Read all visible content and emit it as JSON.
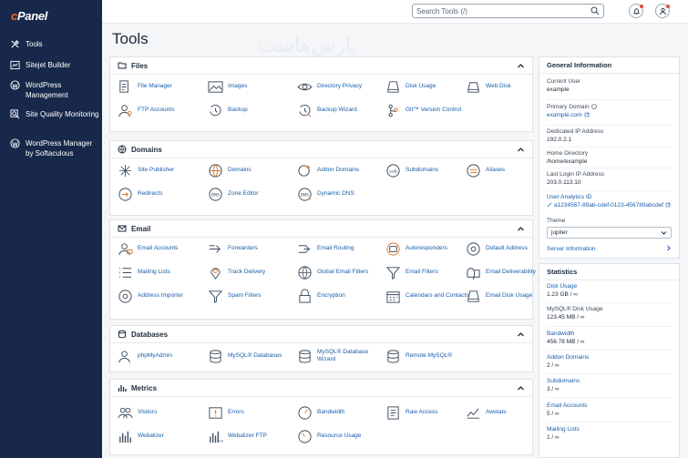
{
  "brand": {
    "logo_c": "c",
    "logo_rest": "Panel"
  },
  "sidebar": {
    "items": [
      {
        "label": "Tools",
        "icon": "tools-icon"
      },
      {
        "label": "Sitejet Builder",
        "icon": "sitejet-icon"
      },
      {
        "label": "WordPress Management",
        "icon": "wordpress-icon"
      },
      {
        "label": "Site Quality Monitoring",
        "icon": "magnifier-icon"
      },
      {
        "label": "WordPress Manager by Softaculous",
        "icon": "wordpress-icon"
      }
    ]
  },
  "header": {
    "search_placeholder": "Search Tools (/)"
  },
  "watermark": "پارس‌هاست",
  "page": {
    "title": "Tools"
  },
  "sections": {
    "files": {
      "title": "Files",
      "tools": [
        "File Manager",
        "Images",
        "Directory Privacy",
        "Disk Usage",
        "Web Disk",
        "FTP Accounts",
        "Backup",
        "Backup Wizard",
        "Git™ Version Control"
      ]
    },
    "domains": {
      "title": "Domains",
      "tools": [
        "Site Publisher",
        "Domains",
        "Addon Domains",
        "Subdomains",
        "Aliases",
        "Redirects",
        "Zone Editor",
        "Dynamic DNS"
      ]
    },
    "email": {
      "title": "Email",
      "tools": [
        "Email Accounts",
        "Forwarders",
        "Email Routing",
        "Autoresponders",
        "Default Address",
        "Mailing Lists",
        "Track Delivery",
        "Global Email Filters",
        "Email Filters",
        "Email Deliverability",
        "Address Importer",
        "Spam Filters",
        "Encryption",
        "Calendars and Contacts",
        "Email Disk Usage"
      ]
    },
    "databases": {
      "title": "Databases",
      "tools": [
        "phpMyAdmin",
        "MySQL® Databases",
        "MySQL® Database Wizard",
        "Remote MySQL®"
      ]
    },
    "metrics": {
      "title": "Metrics",
      "tools": [
        "Visitors",
        "Errors",
        "Bandwidth",
        "Raw Access",
        "Awstats",
        "Webalizer",
        "Webalizer FTP",
        "Resource Usage"
      ]
    }
  },
  "general_info": {
    "title": "General Information",
    "current_user_label": "Current User",
    "current_user": "example",
    "primary_domain_label": "Primary Domain",
    "primary_domain": "example.com",
    "dedicated_ip_label": "Dedicated IP Address",
    "dedicated_ip": "192.0.2.1",
    "home_dir_label": "Home Directory",
    "home_dir": "/home/example",
    "last_login_label": "Last Login IP Address",
    "last_login": "203.0.113.10",
    "analytics_label": "User Analytics ID",
    "analytics_id": "a1234567-89ab-cdef-0123-456789abcdef",
    "theme_label": "Theme",
    "theme": "jupiter",
    "server_info": "Server Information"
  },
  "statistics": {
    "title": "Statistics",
    "items": [
      {
        "label": "Disk Usage",
        "value": "1.23 GB / ∞"
      },
      {
        "label": "MySQL® Disk Usage",
        "value": "123.45 MB / ∞"
      },
      {
        "label": "Bandwidth",
        "value": "456.78 MB / ∞"
      },
      {
        "label": "Addon Domains",
        "value": "2 / ∞"
      },
      {
        "label": "Subdomains",
        "value": "3 / ∞"
      },
      {
        "label": "Email Accounts",
        "value": "5 / ∞"
      },
      {
        "label": "Mailing Lists",
        "value": "1 / ∞"
      }
    ]
  },
  "colors": {
    "sidebar": "#17284a",
    "link": "#175dab",
    "accent": "#ff6c2c"
  }
}
